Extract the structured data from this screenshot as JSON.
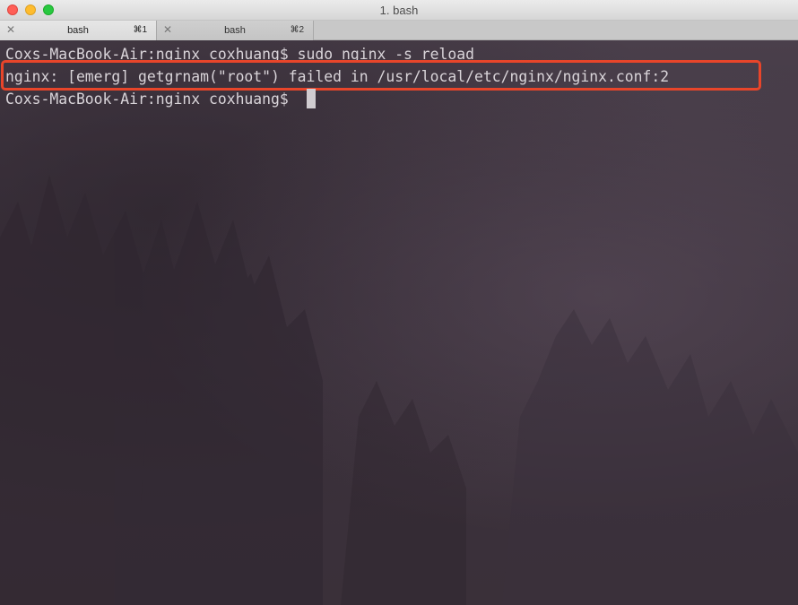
{
  "window": {
    "title": "1. bash"
  },
  "tabs": [
    {
      "label": "bash",
      "shortcut": "⌘1",
      "active": true
    },
    {
      "label": "bash",
      "shortcut": "⌘2",
      "active": false
    }
  ],
  "terminal": {
    "lines": [
      "Coxs-MacBook-Air:nginx coxhuang$ sudo nginx -s reload",
      "nginx: [emerg] getgrnam(\"root\") failed in /usr/local/etc/nginx/nginx.conf:2",
      "Coxs-MacBook-Air:nginx coxhuang$ "
    ]
  },
  "icons": {
    "tab_close": "close-icon",
    "traffic_close": "window-close-icon",
    "traffic_minimize": "window-minimize-icon",
    "traffic_zoom": "window-zoom-icon"
  },
  "colors": {
    "highlight": "#e8452a",
    "text": "#d9d4d9",
    "background": "#3c323d"
  }
}
